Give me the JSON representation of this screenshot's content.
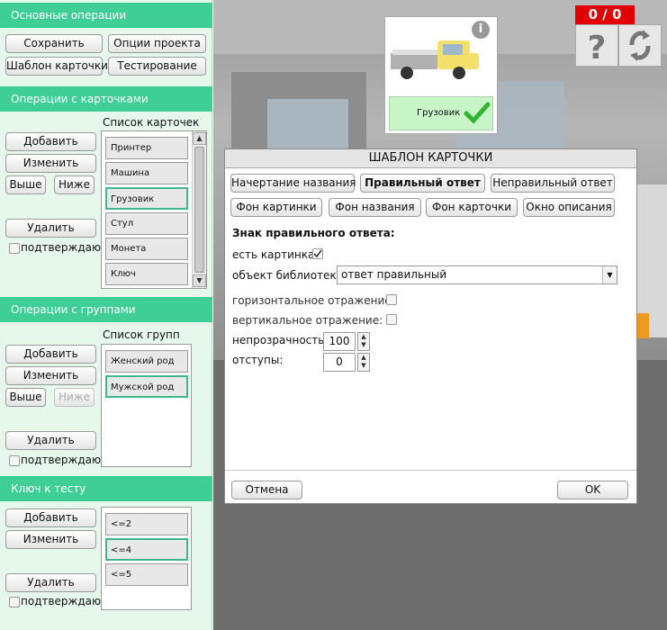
{
  "left_panel": {
    "basic_ops": {
      "title": "Основные операции",
      "save": "Сохранить",
      "project_options": "Опции проекта",
      "card_template": "Шаблон карточки",
      "testing": "Тестирование"
    },
    "card_ops": {
      "title": "Операции с карточками",
      "list_title": "Список карточек",
      "add": "Добавить",
      "edit": "Изменить",
      "up": "Выше",
      "down": "Ниже",
      "delete": "Удалить",
      "confirm": "подтверждаю",
      "items": [
        "Принтер",
        "Машина",
        "Грузовик",
        "Стул",
        "Монета",
        "Ключ"
      ]
    },
    "group_ops": {
      "title": "Операции с группами",
      "list_title": "Список групп",
      "add": "Добавить",
      "edit": "Изменить",
      "up": "Выше",
      "down": "Ниже",
      "delete": "Удалить",
      "confirm": "подтверждаю",
      "items": [
        "Женский род",
        "Мужской род"
      ]
    },
    "test_key": {
      "title": "Ключ к тесту",
      "add": "Добавить",
      "edit": "Изменить",
      "delete": "Удалить",
      "confirm": "подтверждаю",
      "items": [
        "<=2",
        "<=4",
        "<=5"
      ]
    }
  },
  "score": "0 / 0",
  "preview_card": {
    "label": "Грузовик"
  },
  "dialog": {
    "title": "ШАБЛОН КАРТОЧКИ",
    "tabs": [
      "Начертание названия",
      "Правильный ответ",
      "Неправильный ответ",
      "Фон картинки",
      "Фон названия",
      "Фон карточки",
      "Окно описания"
    ],
    "active_tab": "Правильный ответ",
    "section_title": "Знак правильного ответа:",
    "has_picture_label": "есть картинка:",
    "library_label": "объект библиотеки:",
    "library_value": "ответ правильный",
    "h_flip_label": "горизонтальное отражение:",
    "v_flip_label": "вертикальное отражение:",
    "opacity_label": "непрозрачность:",
    "opacity_value": "100",
    "padding_label": "отступы:",
    "padding_value": "0",
    "cancel": "Отмена",
    "ok": "OK"
  },
  "colors": {
    "section_header": "#3fcf96",
    "selected_border": "#3fb98c",
    "score_bg": "#e00000"
  }
}
